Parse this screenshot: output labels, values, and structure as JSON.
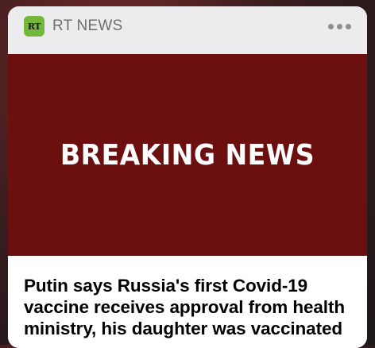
{
  "notification": {
    "app_name": "RT NEWS",
    "app_icon_text": "RT",
    "more_icon": "ellipsis-icon",
    "image_text": "BREAKING NEWS",
    "headline": "Putin says Russia's first Covid-19 vaccine receives approval from health ministry, his daughter was vaccinated"
  },
  "colors": {
    "app_icon_green": "#73b83b",
    "image_background": "#6b0f0f"
  }
}
